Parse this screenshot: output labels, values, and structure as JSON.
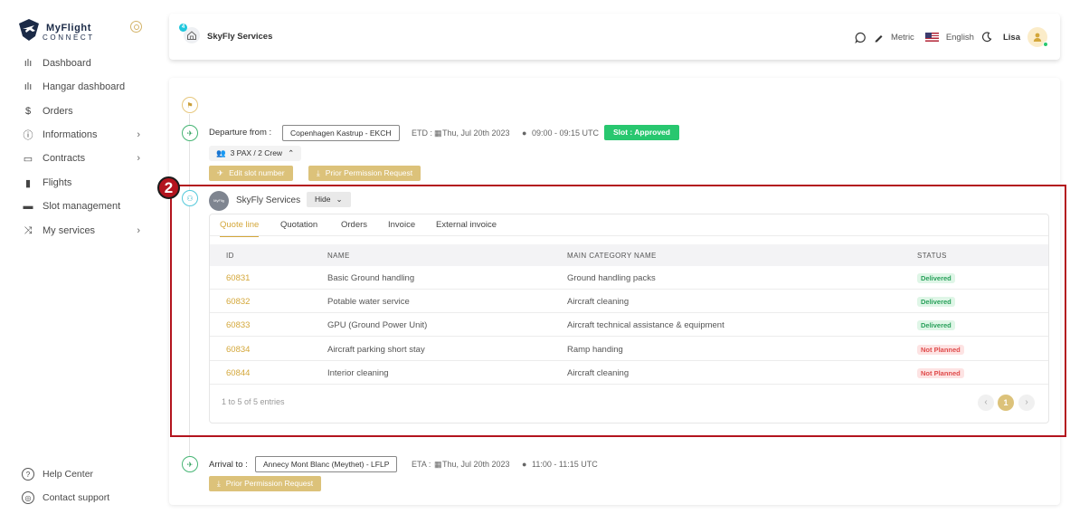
{
  "brand": {
    "name_line1": "MyFlight",
    "name_line2": "CONNECT"
  },
  "sidebar": {
    "items": [
      {
        "label": "Dashboard",
        "icon": "bar-chart-icon",
        "glyph": "ılı"
      },
      {
        "label": "Hangar dashboard",
        "icon": "bar-chart-icon",
        "glyph": "ılı"
      },
      {
        "label": "Orders",
        "icon": "dollar-icon",
        "glyph": "$"
      },
      {
        "label": "Informations",
        "icon": "info-icon",
        "glyph": "ⓘ",
        "chevron": "›"
      },
      {
        "label": "Contracts",
        "icon": "folder-icon",
        "glyph": "▭",
        "chevron": "›"
      },
      {
        "label": "Flights",
        "icon": "briefcase-icon",
        "glyph": "▮"
      },
      {
        "label": "Slot management",
        "icon": "laptop-icon",
        "glyph": "▬"
      },
      {
        "label": "My services",
        "icon": "shuffle-icon",
        "glyph": "⤨",
        "chevron": "›"
      }
    ],
    "bottom": [
      {
        "label": "Help Center",
        "icon": "help-icon",
        "glyph": "?"
      },
      {
        "label": "Contact support",
        "icon": "lifebuoy-icon",
        "glyph": "◎"
      }
    ]
  },
  "header": {
    "badge": "4",
    "company": "SkyFly Services",
    "unit": "Metric",
    "language": "English",
    "user": "Lisa"
  },
  "departure": {
    "label": "Departure from :",
    "airport": "Copenhagen Kastrup - EKCH",
    "etd_label": "ETD :",
    "date": "Thu, Jul 20th 2023",
    "time": "09:00 - 09:15 UTC",
    "slot": "Slot : Approved",
    "pax": "3 PAX  /  2 Crew",
    "edit_slot": "Edit slot number",
    "ppr": "Prior Permission Request"
  },
  "provider": {
    "logo_text": "MyFlig",
    "name": "SkyFly Services",
    "hide": "Hide"
  },
  "annotation": {
    "number": "2"
  },
  "tabs": [
    "Quote line",
    "Quotation",
    "Orders",
    "Invoice",
    "External invoice"
  ],
  "table": {
    "headers": [
      "ID",
      "NAME",
      "MAIN CATEGORY NAME",
      "STATUS"
    ],
    "rows": [
      {
        "id": "60831",
        "name": "Basic Ground handling",
        "category": "Ground handling packs",
        "status": "Delivered"
      },
      {
        "id": "60832",
        "name": "Potable water service",
        "category": "Aircraft cleaning",
        "status": "Delivered"
      },
      {
        "id": "60833",
        "name": "GPU (Ground Power Unit)",
        "category": "Aircraft technical assistance & equipment",
        "status": "Delivered"
      },
      {
        "id": "60834",
        "name": "Aircraft parking short stay",
        "category": "Ramp handing",
        "status": "Not Planned"
      },
      {
        "id": "60844",
        "name": "Interior cleaning",
        "category": "Aircraft cleaning",
        "status": "Not Planned"
      }
    ],
    "entries": "1 to 5 of 5 entries",
    "page": "1",
    "prev": "‹",
    "next": "›"
  },
  "arrival": {
    "label": "Arrival to :",
    "airport": "Annecy Mont Blanc (Meythet) - LFLP",
    "eta_label": "ETA :",
    "date": "Thu, Jul 20th 2023",
    "time": "11:00 - 11:15 UTC",
    "ppr": "Prior Permission Request"
  },
  "colors": {
    "accent": "#d4a73a",
    "gold_button": "#dcc27a",
    "approved": "#28c76f",
    "annotation": "#b3141e"
  }
}
